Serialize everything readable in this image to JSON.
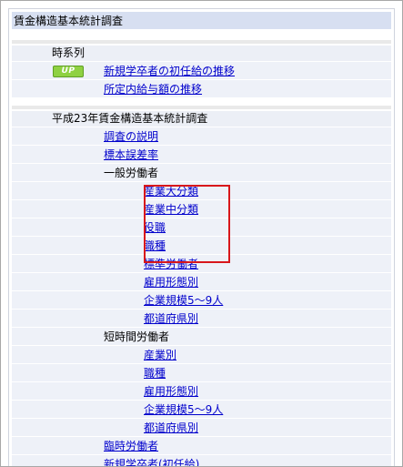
{
  "header": {
    "title": "賃金構造基本統計調査"
  },
  "time_series": {
    "heading": "時系列",
    "badge": "UP",
    "items": [
      {
        "label": "新規学卒者の初任給の推移"
      },
      {
        "label": "所定内給与額の推移"
      }
    ]
  },
  "survey": {
    "heading": "平成23年賃金構造基本統計調査",
    "top_items": [
      {
        "label": "調査の説明"
      },
      {
        "label": "標本誤差率"
      }
    ],
    "general": {
      "label": "一般労働者",
      "items": [
        {
          "label": "産業大分類"
        },
        {
          "label": "産業中分類"
        },
        {
          "label": "役職"
        },
        {
          "label": "職種"
        },
        {
          "label": "標準労働者"
        },
        {
          "label": "雇用形態別"
        },
        {
          "label": "企業規模5～9人"
        },
        {
          "label": "都道府県別"
        }
      ]
    },
    "short_time": {
      "label": "短時間労働者",
      "items": [
        {
          "label": "産業別"
        },
        {
          "label": "職種"
        },
        {
          "label": "雇用形態別"
        },
        {
          "label": "企業規模5～9人"
        },
        {
          "label": "都道府県別"
        }
      ]
    },
    "bottom_items": [
      {
        "label": "臨時労働者"
      },
      {
        "label": "新規学卒者(初任給)"
      }
    ]
  },
  "colors": {
    "header_bg": "#d7dff1",
    "row_bg": "#eef1f8",
    "link": "#0000cc",
    "highlight": "#d8171b"
  }
}
